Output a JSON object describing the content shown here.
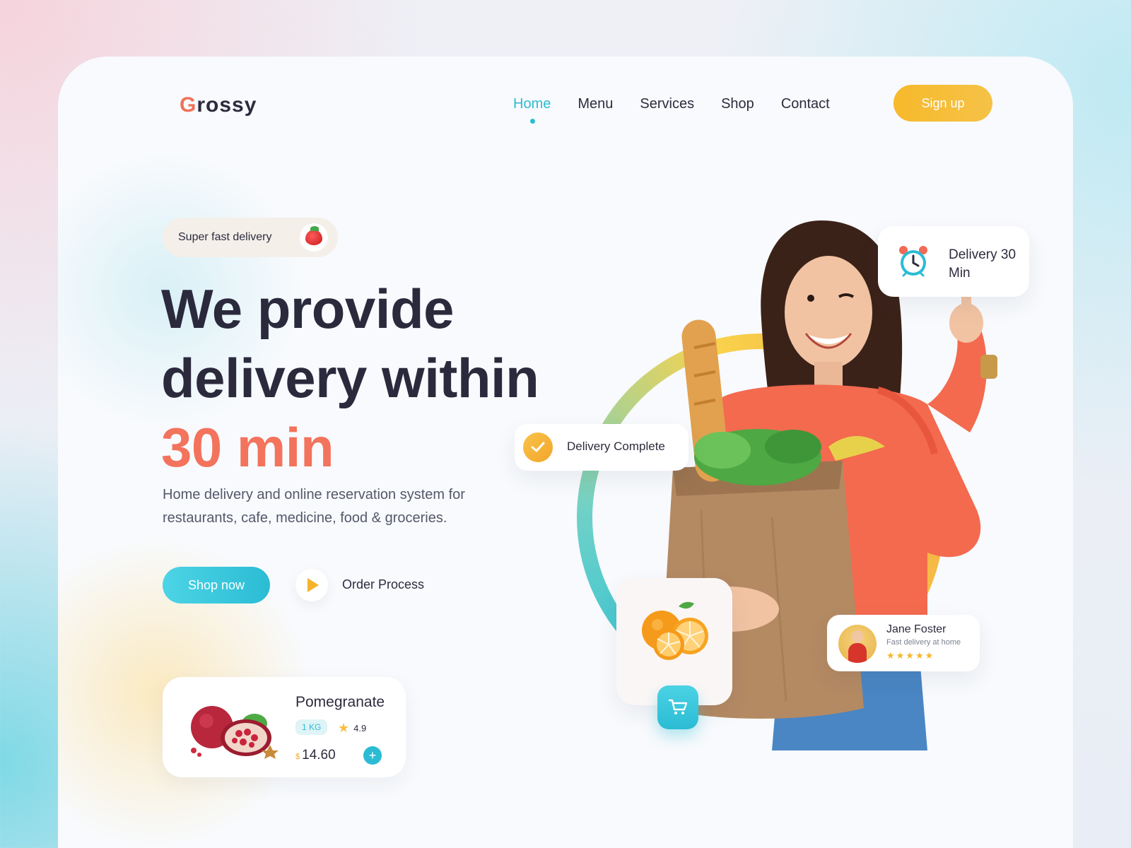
{
  "brand": {
    "logo_initial": "G",
    "logo_rest": "rossy"
  },
  "nav": {
    "items": [
      {
        "label": "Home",
        "active": true
      },
      {
        "label": "Menu"
      },
      {
        "label": "Services"
      },
      {
        "label": "Shop"
      },
      {
        "label": "Contact"
      }
    ],
    "signup_label": "Sign up"
  },
  "hero": {
    "badge_text": "Super fast delivery",
    "headline_line1": "We provide",
    "headline_line2": "delivery within",
    "headline_accent": "30 min",
    "description": "Home delivery and online reservation system for restaurants, cafe, medicine, food & groceries.",
    "shop_button": "Shop now",
    "order_process": "Order Process"
  },
  "product_card": {
    "name": "Pomegranate",
    "unit": "1 KG",
    "rating": "4.9",
    "currency": "$",
    "price": "14.60",
    "add_label": "+"
  },
  "floating": {
    "delivery_time_label": "Delivery 30 Min",
    "delivery_complete": "Delivery Complete",
    "review_name": "Jane Foster",
    "review_text": "Fast delivery at home",
    "review_stars": "★★★★★"
  },
  "colors": {
    "accent_coral": "#f3735c",
    "accent_cyan": "#2bbcd4",
    "accent_yellow": "#f7b92b",
    "text_dark": "#2b2a3d"
  }
}
